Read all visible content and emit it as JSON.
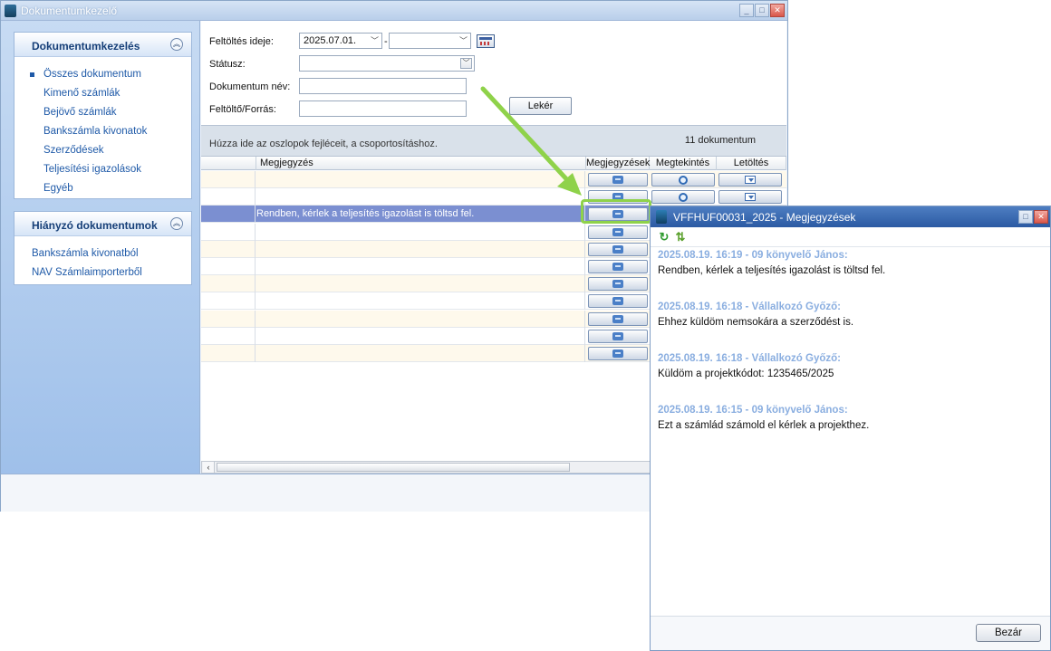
{
  "main_window": {
    "title": "Dokumentumkezelő"
  },
  "sidebar": {
    "panel1": {
      "title": "Dokumentumkezelés",
      "items": [
        {
          "label": "Összes dokumentum"
        },
        {
          "label": "Kimenő számlák"
        },
        {
          "label": "Bejövő számlák"
        },
        {
          "label": "Bankszámla kivonatok"
        },
        {
          "label": "Szerződések"
        },
        {
          "label": "Teljesítési igazolások"
        },
        {
          "label": "Egyéb"
        }
      ]
    },
    "panel2": {
      "title": "Hiányzó dokumentumok",
      "items": [
        {
          "label": "Bankszámla kivonatból"
        },
        {
          "label": "NAV Számlaimporterből"
        }
      ]
    }
  },
  "filters": {
    "upload_date_label": "Feltöltés ideje:",
    "date_from": "2025.07.01.",
    "date_separator": "-",
    "date_to": "",
    "status_label": "Státusz:",
    "status_value": "",
    "doc_name_label": "Dokumentum név:",
    "doc_name_value": "",
    "uploader_label": "Feltöltő/Forrás:",
    "uploader_value": "",
    "query_button": "Lekér"
  },
  "grid": {
    "group_hint": "Húzza ide az oszlopok fejléceit, a csoportosításhoz.",
    "doc_count": "11 dokumentum",
    "columns": [
      "",
      "Megjegyzés",
      "Megjegyzések",
      "Megtekintés",
      "Letöltés"
    ],
    "rows": [
      {
        "note": ""
      },
      {
        "note": ""
      },
      {
        "note": "Rendben, kérlek a teljesítés igazolást is töltsd fel."
      },
      {
        "note": ""
      },
      {
        "note": ""
      },
      {
        "note": ""
      },
      {
        "note": ""
      },
      {
        "note": ""
      },
      {
        "note": ""
      },
      {
        "note": ""
      },
      {
        "note": ""
      }
    ]
  },
  "notes_window": {
    "title": "VFFHUF00031_2025 - Megjegyzések",
    "notes": [
      {
        "header": "2025.08.19. 16:19 - 09 könyvelő János:",
        "text": "Rendben, kérlek a teljesítés igazolást is töltsd fel."
      },
      {
        "header": "2025.08.19. 16:18 - Vállalkozó Győző:",
        "text": "Ehhez küldöm nemsokára a szerződést is."
      },
      {
        "header": "2025.08.19. 16:18 - Vállalkozó Győző:",
        "text": "Küldöm a projektkódot: 1235465/2025"
      },
      {
        "header": "2025.08.19. 16:15 - 09 könyvelő János:",
        "text": "Ezt a számlád számold el kérlek a projekthez."
      }
    ],
    "close_button": "Bezár"
  },
  "colors": {
    "accent": "#1f5aa8",
    "selected_row": "#7b8fd1",
    "highlight": "#8fd24a",
    "note_header": "#8aaee0"
  }
}
